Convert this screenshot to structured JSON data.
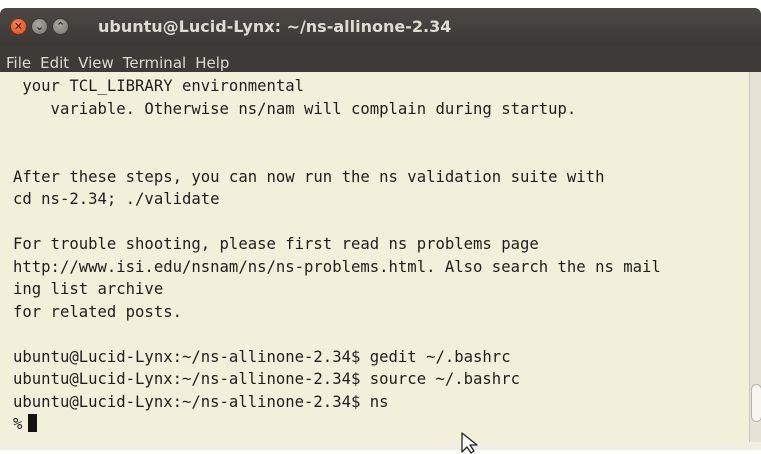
{
  "window": {
    "title": "ubuntu@Lucid-Lynx: ~/ns-allinone-2.34",
    "buttons": {
      "close": "✕",
      "minimize": "⌄",
      "maximize": "⌃"
    }
  },
  "menubar": {
    "items": [
      "File",
      "Edit",
      "View",
      "Terminal",
      "Help"
    ]
  },
  "terminal": {
    "lines": [
      " your TCL_LIBRARY environmental",
      "    variable. Otherwise ns/nam will complain during startup.",
      "",
      "",
      "After these steps, you can now run the ns validation suite with",
      "cd ns-2.34; ./validate",
      "",
      "For trouble shooting, please first read ns problems page",
      "http://www.isi.edu/nsnam/ns/ns-problems.html. Also search the ns mail",
      "ing list archive",
      "for related posts.",
      "",
      "ubuntu@Lucid-Lynx:~/ns-allinone-2.34$ gedit ~/.bashrc",
      "ubuntu@Lucid-Lynx:~/ns-allinone-2.34$ source ~/.bashrc",
      "ubuntu@Lucid-Lynx:~/ns-allinone-2.34$ ns"
    ],
    "prompt": "%"
  },
  "icons": {
    "close": "close-icon",
    "minimize": "minimize-icon",
    "maximize": "maximize-icon",
    "pointer": "mouse-pointer-icon"
  },
  "colors": {
    "titlebar": "#3c3b37",
    "close_button": "#e2562b",
    "terminal_bg": "#f2f0da",
    "terminal_text": "#1e1e1e"
  }
}
